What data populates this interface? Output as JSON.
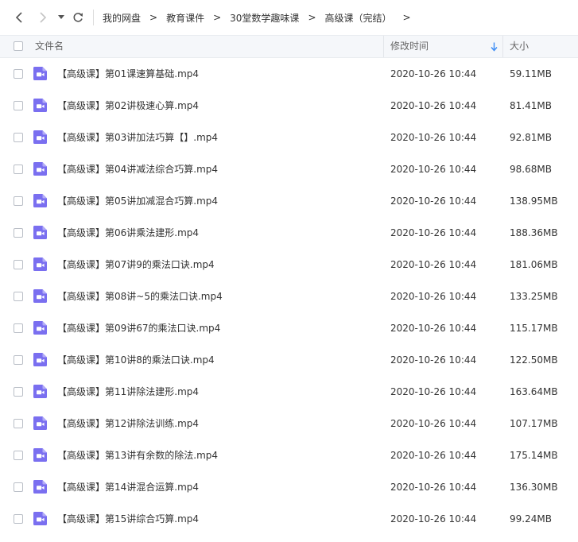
{
  "nav": {
    "back_icon": "chevron-left-icon",
    "forward_icon": "chevron-right-icon",
    "dropdown_icon": "caret-down-icon",
    "refresh_icon": "refresh-icon"
  },
  "breadcrumb": {
    "items": [
      "我的网盘",
      "教育课件",
      "30堂数学趣味课",
      "高级课（完结）"
    ],
    "separator": ">"
  },
  "table": {
    "columns": {
      "name": "文件名",
      "modified": "修改时间",
      "size": "大小"
    },
    "sort_icon": "arrow-down-icon",
    "rows": [
      {
        "name": "【高级课】第01课速算基础.mp4",
        "modified": "2020-10-26 10:44",
        "size": "59.11MB"
      },
      {
        "name": "【高级课】第02讲极速心算.mp4",
        "modified": "2020-10-26 10:44",
        "size": "81.41MB"
      },
      {
        "name": "【高级课】第03讲加法巧算【】.mp4",
        "modified": "2020-10-26 10:44",
        "size": "92.81MB"
      },
      {
        "name": "【高级课】第04讲减法综合巧算.mp4",
        "modified": "2020-10-26 10:44",
        "size": "98.68MB"
      },
      {
        "name": "【高级课】第05讲加减混合巧算.mp4",
        "modified": "2020-10-26 10:44",
        "size": "138.95MB"
      },
      {
        "name": "【高级课】第06讲乘法建形.mp4",
        "modified": "2020-10-26 10:44",
        "size": "188.36MB"
      },
      {
        "name": "【高级课】第07讲9的乘法口诀.mp4",
        "modified": "2020-10-26 10:44",
        "size": "181.06MB"
      },
      {
        "name": "【高级课】第08讲~5的乘法口诀.mp4",
        "modified": "2020-10-26 10:44",
        "size": "133.25MB"
      },
      {
        "name": "【高级课】第09讲67的乘法口诀.mp4",
        "modified": "2020-10-26 10:44",
        "size": "115.17MB"
      },
      {
        "name": "【高级课】第10讲8的乘法口诀.mp4",
        "modified": "2020-10-26 10:44",
        "size": "122.50MB"
      },
      {
        "name": "【高级课】第11讲除法建形.mp4",
        "modified": "2020-10-26 10:44",
        "size": "163.64MB"
      },
      {
        "name": "【高级课】第12讲除法训练.mp4",
        "modified": "2020-10-26 10:44",
        "size": "107.17MB"
      },
      {
        "name": "【高级课】第13讲有余数的除法.mp4",
        "modified": "2020-10-26 10:44",
        "size": "175.14MB"
      },
      {
        "name": "【高级课】第14讲混合运算.mp4",
        "modified": "2020-10-26 10:44",
        "size": "136.30MB"
      },
      {
        "name": "【高级课】第15讲综合巧算.mp4",
        "modified": "2020-10-26 10:44",
        "size": "99.24MB"
      }
    ]
  },
  "colors": {
    "video_icon": "#7a6ff0",
    "sort_arrow": "#3b8cf5"
  }
}
